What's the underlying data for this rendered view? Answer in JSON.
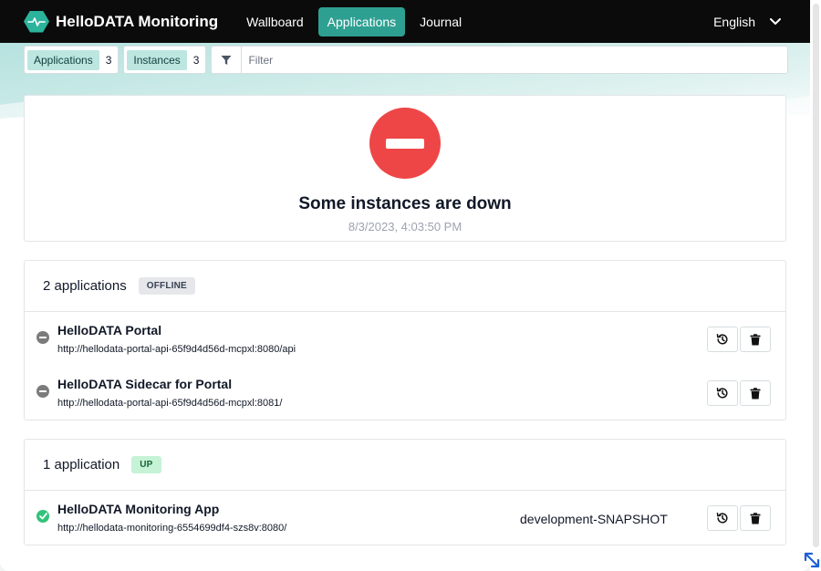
{
  "brand": {
    "title": "HelloDATA Monitoring"
  },
  "nav": {
    "items": [
      {
        "label": "Wallboard",
        "active": false
      },
      {
        "label": "Applications",
        "active": true
      },
      {
        "label": "Journal",
        "active": false
      }
    ],
    "language": "English"
  },
  "filters": {
    "applications": {
      "label": "Applications",
      "count": "3"
    },
    "instances": {
      "label": "Instances",
      "count": "3"
    },
    "placeholder": "Filter"
  },
  "status": {
    "title": "Some instances are down",
    "timestamp": "8/3/2023, 4:03:50 PM"
  },
  "groups": [
    {
      "title": "2 applications",
      "badge": "OFFLINE",
      "apps": [
        {
          "name": "HelloDATA Portal",
          "url": "http://hellodata-portal-api-65f9d4d56d-mcpxl:8080/api",
          "version": ""
        },
        {
          "name": "HelloDATA Sidecar for Portal",
          "url": "http://hellodata-portal-api-65f9d4d56d-mcpxl:8081/",
          "version": ""
        }
      ]
    },
    {
      "title": "1 application",
      "badge": "UP",
      "apps": [
        {
          "name": "HelloDATA Monitoring App",
          "url": "http://hellodata-monitoring-6554699df4-szs8v:8080/",
          "version": "development-SNAPSHOT"
        }
      ]
    }
  ],
  "colors": {
    "accent": "#2ea092",
    "down": "#ee4646",
    "offline": "#7b7b7b",
    "up": "#32c27a"
  },
  "icons": {
    "logo": "heartbeat-hexagon-icon",
    "language": "chevron-down-icon",
    "filter": "filter-funnel-icon",
    "status": "minus-circle-icon",
    "restart": "history-icon",
    "delete": "trash-icon"
  }
}
